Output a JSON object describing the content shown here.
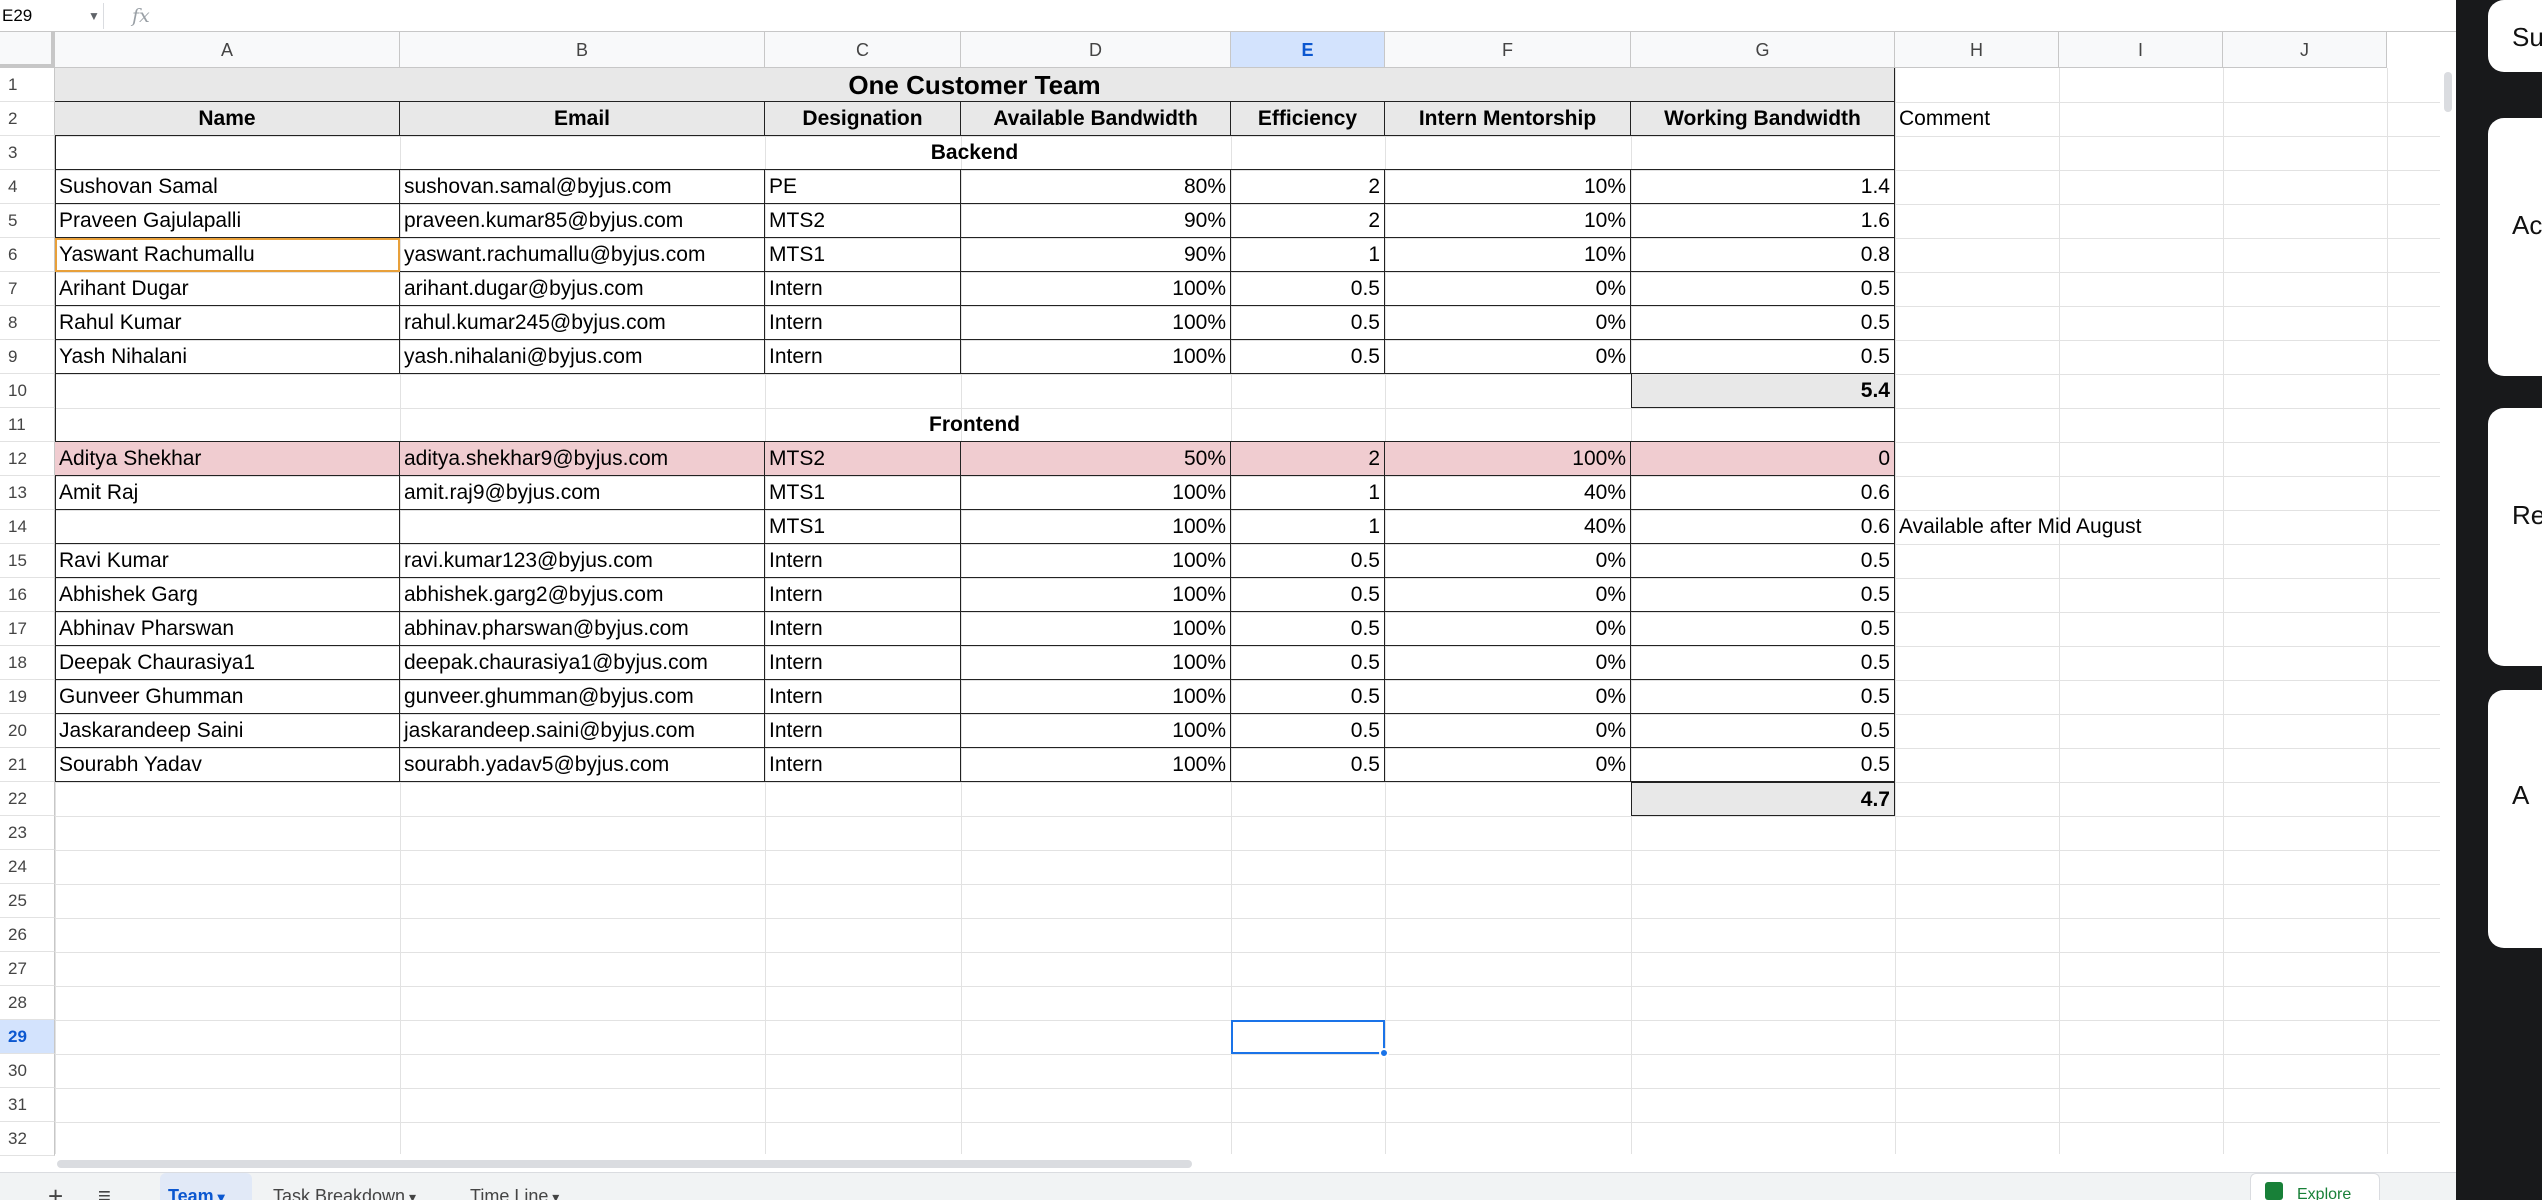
{
  "formula_bar": {
    "cell_ref": "E29",
    "fx": "fx",
    "content": ""
  },
  "columns": [
    "A",
    "B",
    "C",
    "D",
    "E",
    "F",
    "G",
    "H",
    "I",
    "J"
  ],
  "selected_column": "E",
  "rows": [
    "1",
    "2",
    "3",
    "4",
    "5",
    "6",
    "7",
    "8",
    "9",
    "10",
    "11",
    "12",
    "13",
    "14",
    "15",
    "16",
    "17",
    "18",
    "19",
    "20",
    "21",
    "22",
    "23",
    "24",
    "25",
    "26",
    "27",
    "28",
    "29",
    "30",
    "31",
    "32"
  ],
  "selected_row": "29",
  "sheet": {
    "title": "One Customer Team",
    "headers": [
      "Name",
      "Email",
      "Designation",
      "Available Bandwidth",
      "Efficiency",
      "Intern Mentorship",
      "Working Bandwidth"
    ],
    "comment_header": "Comment",
    "backend": {
      "label": "Backend",
      "rows": [
        {
          "name": "Sushovan Samal",
          "email": "sushovan.samal@byjus.com",
          "designation": "PE",
          "available": "80%",
          "efficiency": "2",
          "mentorship": "10%",
          "working": "1.4",
          "comment": ""
        },
        {
          "name": "Praveen Gajulapalli",
          "email": "praveen.kumar85@byjus.com",
          "designation": "MTS2",
          "available": "90%",
          "efficiency": "2",
          "mentorship": "10%",
          "working": "1.6",
          "comment": ""
        },
        {
          "name": "Yaswant Rachumallu",
          "email": "yaswant.rachumallu@byjus.com",
          "designation": "MTS1",
          "available": "90%",
          "efficiency": "1",
          "mentorship": "10%",
          "working": "0.8",
          "comment": ""
        },
        {
          "name": "Arihant Dugar",
          "email": "arihant.dugar@byjus.com",
          "designation": "Intern",
          "available": "100%",
          "efficiency": "0.5",
          "mentorship": "0%",
          "working": "0.5",
          "comment": ""
        },
        {
          "name": "Rahul Kumar",
          "email": "rahul.kumar245@byjus.com",
          "designation": "Intern",
          "available": "100%",
          "efficiency": "0.5",
          "mentorship": "0%",
          "working": "0.5",
          "comment": ""
        },
        {
          "name": "Yash Nihalani",
          "email": "yash.nihalani@byjus.com",
          "designation": "Intern",
          "available": "100%",
          "efficiency": "0.5",
          "mentorship": "0%",
          "working": "0.5",
          "comment": ""
        }
      ],
      "total": "5.4"
    },
    "frontend": {
      "label": "Frontend",
      "rows": [
        {
          "name": "Aditya Shekhar",
          "email": "aditya.shekhar9@byjus.com",
          "designation": "MTS2",
          "available": "50%",
          "efficiency": "2",
          "mentorship": "100%",
          "working": "0",
          "comment": "",
          "highlight": "#f0ccd0"
        },
        {
          "name": "Amit Raj",
          "email": "amit.raj9@byjus.com",
          "designation": "MTS1",
          "available": "100%",
          "efficiency": "1",
          "mentorship": "40%",
          "working": "0.6",
          "comment": ""
        },
        {
          "name": "",
          "email": "",
          "designation": "MTS1",
          "available": "100%",
          "efficiency": "1",
          "mentorship": "40%",
          "working": "0.6",
          "comment": "Available after Mid August"
        },
        {
          "name": "Ravi Kumar",
          "email": "ravi.kumar123@byjus.com",
          "designation": "Intern",
          "available": "100%",
          "efficiency": "0.5",
          "mentorship": "0%",
          "working": "0.5",
          "comment": ""
        },
        {
          "name": "Abhishek Garg",
          "email": "abhishek.garg2@byjus.com",
          "designation": "Intern",
          "available": "100%",
          "efficiency": "0.5",
          "mentorship": "0%",
          "working": "0.5",
          "comment": ""
        },
        {
          "name": "Abhinav Pharswan",
          "email": "abhinav.pharswan@byjus.com",
          "designation": "Intern",
          "available": "100%",
          "efficiency": "0.5",
          "mentorship": "0%",
          "working": "0.5",
          "comment": ""
        },
        {
          "name": "Deepak Chaurasiya1",
          "email": "deepak.chaurasiya1@byjus.com",
          "designation": "Intern",
          "available": "100%",
          "efficiency": "0.5",
          "mentorship": "0%",
          "working": "0.5",
          "comment": ""
        },
        {
          "name": "Gunveer Ghumman",
          "email": "gunveer.ghumman@byjus.com",
          "designation": "Intern",
          "available": "100%",
          "efficiency": "0.5",
          "mentorship": "0%",
          "working": "0.5",
          "comment": ""
        },
        {
          "name": "Jaskarandeep Saini",
          "email": "jaskarandeep.saini@byjus.com",
          "designation": "Intern",
          "available": "100%",
          "efficiency": "0.5",
          "mentorship": "0%",
          "working": "0.5",
          "comment": ""
        },
        {
          "name": "Sourabh Yadav",
          "email": "sourabh.yadav5@byjus.com",
          "designation": "Intern",
          "available": "100%",
          "efficiency": "0.5",
          "mentorship": "0%",
          "working": "0.5",
          "comment": ""
        }
      ],
      "total": "4.7"
    }
  },
  "tabs": [
    {
      "label": "Team",
      "active": true
    },
    {
      "label": "Task Breakdown",
      "active": false
    },
    {
      "label": "Time Line",
      "active": false
    }
  ],
  "icons": {
    "add_sheet": "plus-icon",
    "all_sheets": "list-icon",
    "dropdown": "caret-down-icon",
    "explore": "explore-icon"
  },
  "explore_label": "Explore",
  "side_panel_cards": [
    "Su",
    "Ac",
    "Re",
    "A"
  ],
  "colors": {
    "accent": "#1a73e8",
    "header_fill": "#e8e8e8",
    "highlight": "#f0ccd0"
  }
}
